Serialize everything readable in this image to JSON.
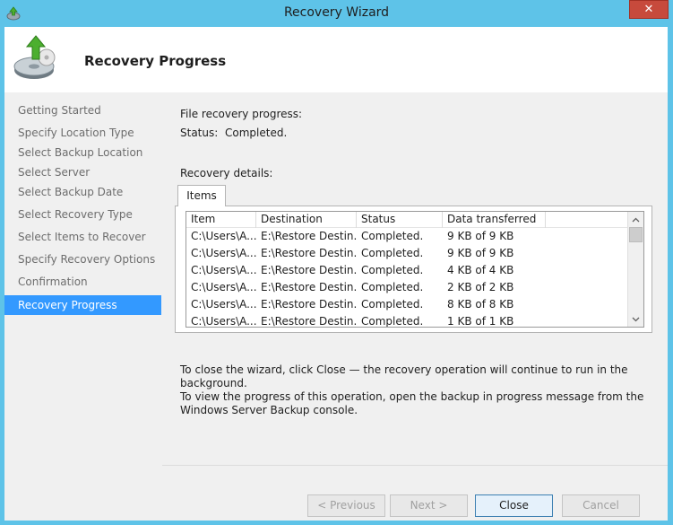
{
  "window": {
    "title": "Recovery Wizard",
    "close_glyph": "✕"
  },
  "header": {
    "title": "Recovery Progress"
  },
  "sidebar": {
    "items": [
      {
        "label": "Getting Started"
      },
      {
        "label": "Specify Location Type"
      },
      {
        "label": "Select Backup Location"
      },
      {
        "label": "Select Server"
      },
      {
        "label": "Select Backup Date"
      },
      {
        "label": "Select Recovery Type"
      },
      {
        "label": "Select Items to Recover"
      },
      {
        "label": "Specify Recovery Options"
      },
      {
        "label": "Confirmation"
      },
      {
        "label": "Recovery Progress",
        "active": true
      }
    ]
  },
  "main": {
    "progress_label": "File recovery progress:",
    "status_label": "Status:",
    "status_value": "Completed.",
    "details_label": "Recovery details:",
    "tab_label": "Items",
    "columns": [
      "Item",
      "Destination",
      "Status",
      "Data transferred"
    ],
    "rows": [
      [
        "C:\\Users\\A...",
        "E:\\Restore Destin...",
        "Completed.",
        "9 KB of 9 KB"
      ],
      [
        "C:\\Users\\A...",
        "E:\\Restore Destin...",
        "Completed.",
        "9 KB of 9 KB"
      ],
      [
        "C:\\Users\\A...",
        "E:\\Restore Destin...",
        "Completed.",
        "4 KB of 4 KB"
      ],
      [
        "C:\\Users\\A...",
        "E:\\Restore Destin...",
        "Completed.",
        "2 KB of 2 KB"
      ],
      [
        "C:\\Users\\A...",
        "E:\\Restore Destin...",
        "Completed.",
        "8 KB of 8 KB"
      ],
      [
        "C:\\Users\\A...",
        "E:\\Restore Destin...",
        "Completed.",
        "1 KB of 1 KB"
      ]
    ],
    "info_line1": "To close the wizard, click Close — the recovery operation will continue to run in the background.",
    "info_line2": "To view the progress of this operation, open the backup in progress message from the Windows Server Backup console."
  },
  "footer": {
    "previous_label": "< Previous",
    "next_label": "Next >",
    "close_label": "Close",
    "cancel_label": "Cancel"
  },
  "colors": {
    "frame": "#5ec3e8",
    "selection": "#3399ff",
    "close_button": "#c74a3c"
  }
}
